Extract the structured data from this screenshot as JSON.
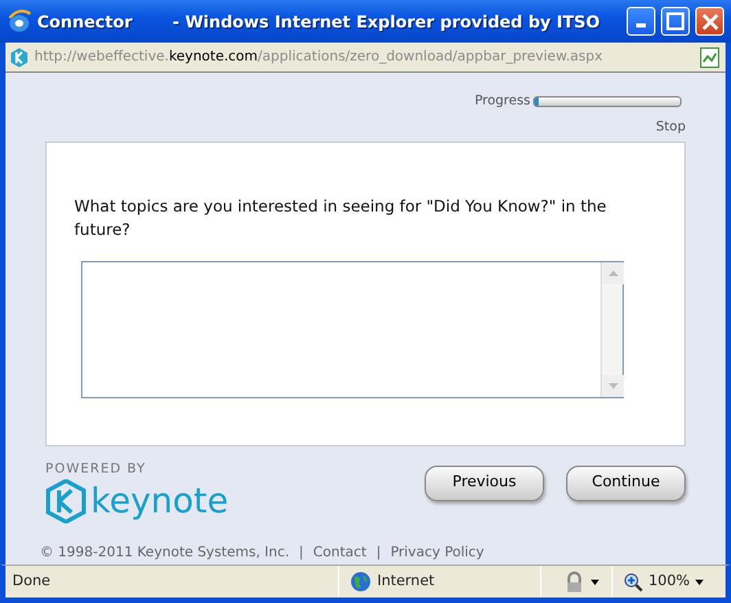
{
  "window": {
    "title": "Connector       - Windows Internet Explorer provided by ITSO"
  },
  "address_bar": {
    "prefix": "http://webeffective.",
    "host": "keynote.com",
    "path": "/applications/zero_download/appbar_preview.aspx"
  },
  "progress": {
    "label": "Progress",
    "level": 0.03,
    "stop": "Stop"
  },
  "question": {
    "text": "What topics are you interested in seeing for \"Did You Know?\" in the future?"
  },
  "branding": {
    "powered_by": "POWERED BY",
    "logo": "keynote"
  },
  "buttons": [
    {
      "label": "Previous"
    },
    {
      "label": "Continue"
    }
  ],
  "footer": {
    "copyright": "© 1998-2011 Keynote Systems, Inc.",
    "separator": "|",
    "links": [
      "Contact",
      "Privacy Policy"
    ]
  },
  "status_bar": {
    "status": "Done",
    "zone": "Internet",
    "zoom": "100%"
  }
}
